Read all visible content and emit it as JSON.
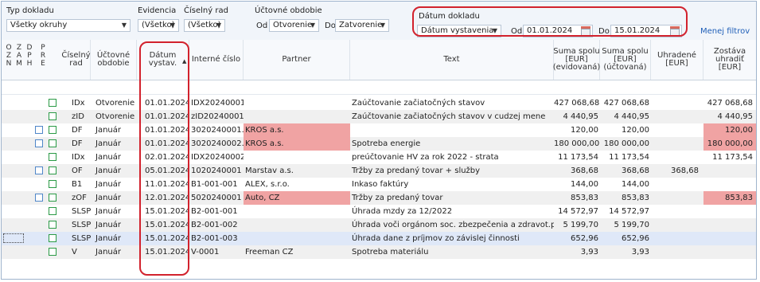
{
  "filters": {
    "typ_label": "Typ dokladu",
    "typ_value": "Všetky okruhy",
    "evidencia_label": "Evidencia",
    "evidencia_value": "(Všetko)",
    "ciselny_label": "Číselný rad",
    "ciselny_value": "(Všetko)",
    "obdobie_label": "Účtovné obdobie",
    "od_label": "Od",
    "od_value": "Otvorenie",
    "do_label": "Do",
    "do_value": "Zatvorenie",
    "datum_label": "Dátum dokladu",
    "datum_type": "Dátum vystavenia",
    "datum_od_label": "Od",
    "datum_od": "01.01.2024",
    "datum_do_label": "Do",
    "datum_do": "15.01.2024",
    "menej_filtrov": "Menej filtrov"
  },
  "columns": {
    "flags": [
      "O\nZ\nN",
      "Z\nA\nM",
      "D\nP\nH",
      "P\nR\nE"
    ],
    "ciselny_rad": "Číselný\nrad",
    "uctovne_obdobie": "Účtovné\nobdobie",
    "datum": "Dátum\nvystav.",
    "interne_cislo": "Interné číslo",
    "partner": "Partner",
    "text": "Text",
    "suma_evid": "Suma spolu\n[EUR]\n(evidovaná)",
    "suma_uct": "Suma spolu\n[EUR]\n(účtovaná)",
    "uhradene": "Uhradené\n[EUR]",
    "zostava": "Zostáva\nuhradiť\n[EUR]"
  },
  "rows": [
    {
      "dph": false,
      "rad": "IDx",
      "obdobie": "Otvorenie",
      "datum": "01.01.2024",
      "cislo": "IDX20240001",
      "partner": "",
      "partner_red": false,
      "text": "Zaúčtovanie začiatočných stavov",
      "suma_evid": "427 068,68",
      "suma_uct": "427 068,68",
      "uhradene": "",
      "zostava": "427 068,68",
      "zostava_red": false
    },
    {
      "dph": false,
      "rad": "zID",
      "obdobie": "Otvorenie",
      "datum": "01.01.2024",
      "cislo": "zID20240001",
      "partner": "",
      "partner_red": false,
      "text": "Zaúčtovanie začiatočných stavov v cudzej mene",
      "suma_evid": "4 440,95",
      "suma_uct": "4 440,95",
      "uhradene": "",
      "zostava": "4 440,95",
      "zostava_red": false
    },
    {
      "dph": true,
      "rad": "DF",
      "obdobie": "Január",
      "datum": "01.01.2024",
      "cislo": "3020240001...",
      "partner": "KROS a.s.",
      "partner_red": true,
      "text": "",
      "suma_evid": "120,00",
      "suma_uct": "120,00",
      "uhradene": "",
      "zostava": "120,00",
      "zostava_red": true
    },
    {
      "dph": true,
      "rad": "DF",
      "obdobie": "Január",
      "datum": "01.01.2024",
      "cislo": "3020240002...",
      "partner": "KROS a.s.",
      "partner_red": true,
      "text": "Spotreba energie",
      "suma_evid": "180 000,00",
      "suma_uct": "180 000,00",
      "uhradene": "",
      "zostava": "180 000,00",
      "zostava_red": true
    },
    {
      "dph": false,
      "rad": "IDx",
      "obdobie": "Január",
      "datum": "02.01.2024",
      "cislo": "IDX20240002",
      "partner": "",
      "partner_red": false,
      "text": "preúčtovanie HV za rok 2022 - strata",
      "suma_evid": "11 173,54",
      "suma_uct": "11 173,54",
      "uhradene": "",
      "zostava": "11 173,54",
      "zostava_red": false
    },
    {
      "dph": true,
      "rad": "OF",
      "obdobie": "Január",
      "datum": "05.01.2024",
      "cislo": "1020240001",
      "partner": "Marstav a.s.",
      "partner_red": false,
      "text": "Tržby za predaný tovar + služby",
      "suma_evid": "368,68",
      "suma_uct": "368,68",
      "uhradene": "368,68",
      "zostava": "",
      "zostava_red": false
    },
    {
      "dph": false,
      "rad": "B1",
      "obdobie": "Január",
      "datum": "11.01.2024",
      "cislo": "B1-001-001",
      "partner": "ALEX, s.r.o.",
      "partner_red": false,
      "text": "Inkaso faktúry",
      "suma_evid": "144,00",
      "suma_uct": "144,00",
      "uhradene": "",
      "zostava": "",
      "zostava_red": false
    },
    {
      "dph": true,
      "rad": "zOF",
      "obdobie": "Január",
      "datum": "12.01.2024",
      "cislo": "5020240001",
      "partner": "Auto, CZ",
      "partner_red": true,
      "text": "Tržby za predaný tovar",
      "suma_evid": "853,83",
      "suma_uct": "853,83",
      "uhradene": "",
      "zostava": "853,83",
      "zostava_red": true
    },
    {
      "dph": false,
      "rad": "SLSP",
      "obdobie": "Január",
      "datum": "15.01.2024",
      "cislo": "B2-001-001",
      "partner": "",
      "partner_red": false,
      "text": "Úhrada mzdy za 12/2022",
      "suma_evid": "14 572,97",
      "suma_uct": "14 572,97",
      "uhradene": "",
      "zostava": "",
      "zostava_red": false
    },
    {
      "dph": false,
      "rad": "SLSP",
      "obdobie": "Január",
      "datum": "15.01.2024",
      "cislo": "B2-001-002",
      "partner": "",
      "partner_red": false,
      "text": "Úhrada voči orgánom soc. zbezpečenia a zdravot.po...",
      "suma_evid": "5 199,70",
      "suma_uct": "5 199,70",
      "uhradene": "",
      "zostava": "",
      "zostava_red": false
    },
    {
      "dph": false,
      "rad": "SLSP",
      "obdobie": "Január",
      "datum": "15.01.2024",
      "cislo": "B2-001-003",
      "partner": "",
      "partner_red": false,
      "text": "Úhrada dane z príjmov zo závislej činnosti",
      "suma_evid": "652,96",
      "suma_uct": "652,96",
      "uhradene": "",
      "zostava": "",
      "zostava_red": false,
      "selected": true
    },
    {
      "dph": false,
      "rad": "V",
      "obdobie": "Január",
      "datum": "15.01.2024",
      "cislo": "V-0001",
      "partner": "Freeman CZ",
      "partner_red": false,
      "text": "Spotreba materiálu",
      "suma_evid": "3,93",
      "suma_uct": "3,93",
      "uhradene": "",
      "zostava": "",
      "zostava_red": false
    }
  ]
}
